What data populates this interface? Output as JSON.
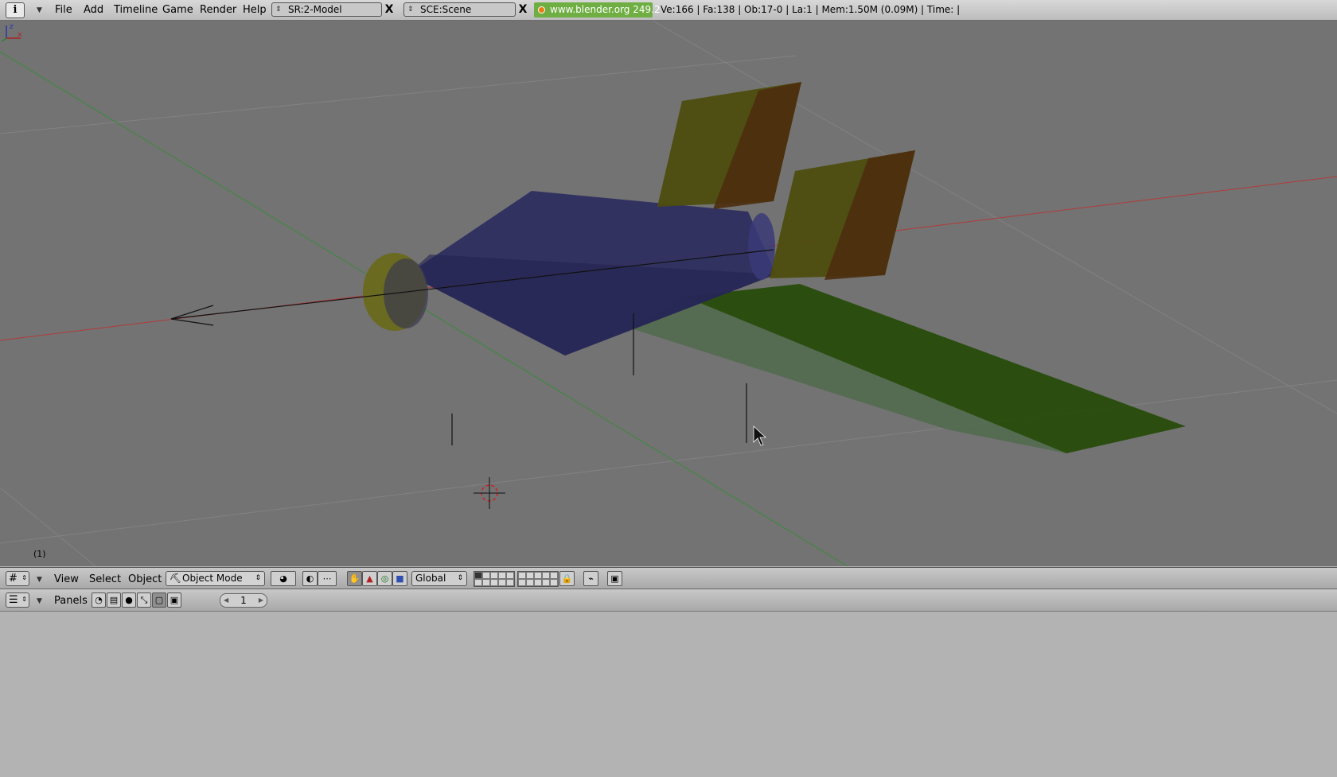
{
  "topbar": {
    "menus": [
      "File",
      "Add",
      "Timeline",
      "Game",
      "Render",
      "Help"
    ],
    "screen": "SR:2-Model",
    "scene": "SCE:Scene",
    "link": "www.blender.org 249.2",
    "stats": "Ve:166 | Fa:138 | Ob:17-0 | La:1  | Mem:1.50M (0.09M)  | Time: |"
  },
  "viewport": {
    "frame": "(1)",
    "axis_labels": {
      "z": "z",
      "x": "x"
    }
  },
  "view3d_header": {
    "menus": [
      "View",
      "Select",
      "Object"
    ],
    "mode": "Object Mode",
    "orientation": "Global"
  },
  "buttons_header": {
    "panels_label": "Panels",
    "frame_value": "1"
  },
  "icons": {
    "info": "i",
    "close": "X",
    "updown": "⇕",
    "dropdown": "▼",
    "mode": "⛏",
    "hand": "✋",
    "triangle": "▲",
    "circle": "◎",
    "square": "■",
    "lock": "🔒",
    "render": "▣"
  },
  "colors": {
    "viewport_bg": "#737373",
    "link_bg": "#6fae42",
    "x_axis": "#b33a3a",
    "y_axis": "#3a8a3a"
  }
}
